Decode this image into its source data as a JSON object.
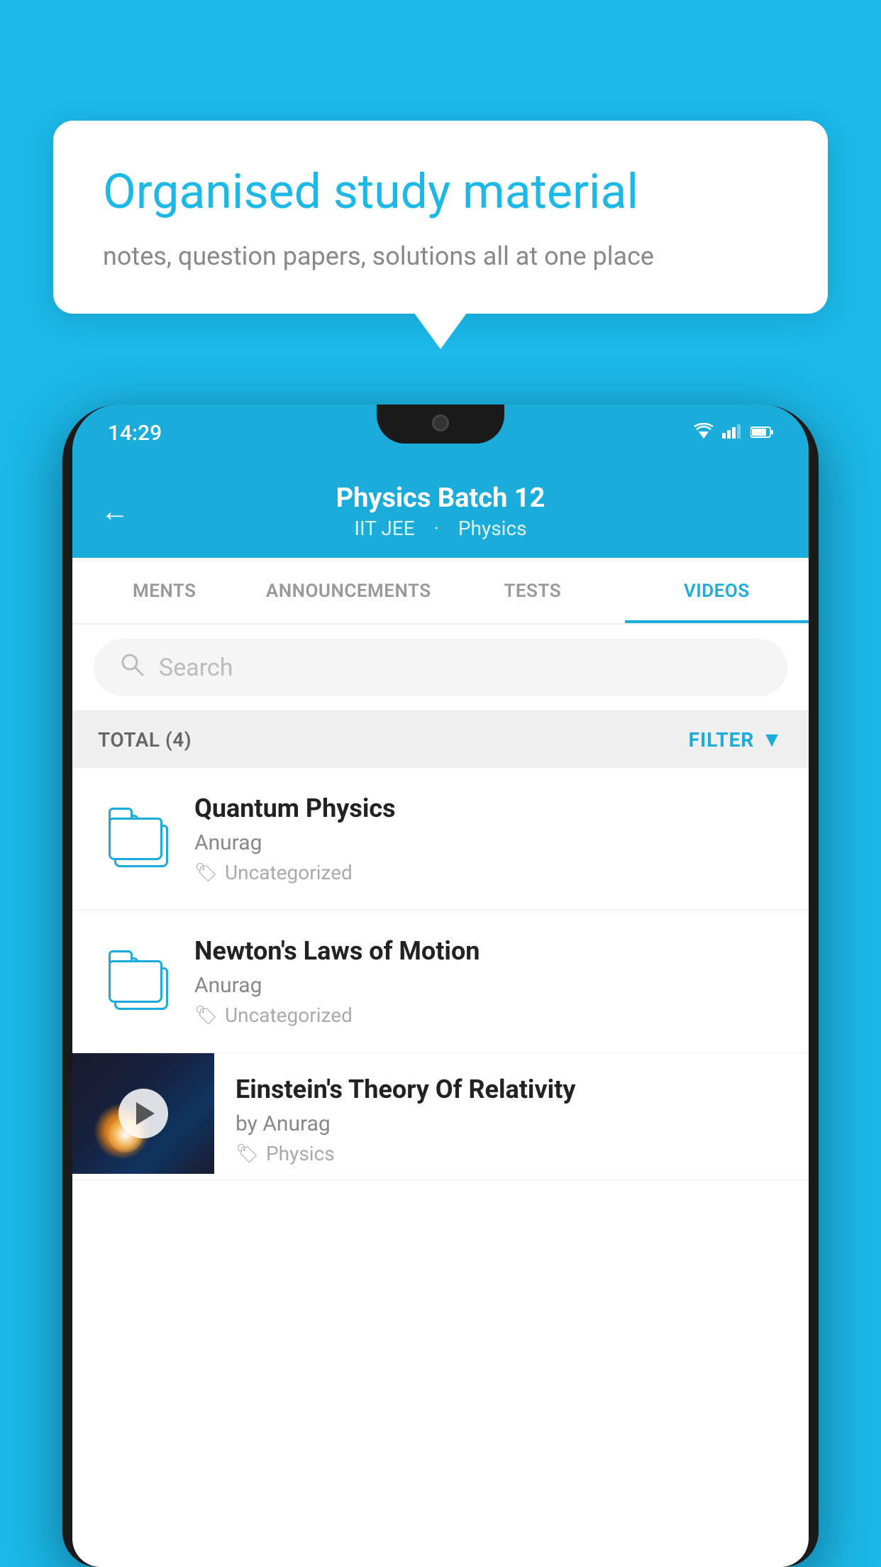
{
  "background_color": "#1BB8E8",
  "speech_bubble": {
    "title": "Organised study material",
    "subtitle": "notes, question papers, solutions all at one place"
  },
  "phone": {
    "status_bar": {
      "time": "14:29",
      "wifi_icon": "wifi",
      "signal_icon": "signal",
      "battery_icon": "battery"
    },
    "header": {
      "back_label": "←",
      "title": "Physics Batch 12",
      "tag1": "IIT JEE",
      "tag2": "Physics"
    },
    "tabs": [
      {
        "label": "MENTS",
        "active": false
      },
      {
        "label": "ANNOUNCEMENTS",
        "active": false
      },
      {
        "label": "TESTS",
        "active": false
      },
      {
        "label": "VIDEOS",
        "active": true
      }
    ],
    "search": {
      "placeholder": "Search"
    },
    "filter_bar": {
      "total_label": "TOTAL (4)",
      "filter_label": "FILTER"
    },
    "video_list": [
      {
        "id": 1,
        "title": "Quantum Physics",
        "author": "Anurag",
        "tag": "Uncategorized",
        "type": "folder",
        "has_thumbnail": false
      },
      {
        "id": 2,
        "title": "Newton's Laws of Motion",
        "author": "Anurag",
        "tag": "Uncategorized",
        "type": "folder",
        "has_thumbnail": false
      },
      {
        "id": 3,
        "title": "Einstein's Theory Of Relativity",
        "author": "by Anurag",
        "tag": "Physics",
        "type": "video",
        "has_thumbnail": true
      }
    ]
  }
}
